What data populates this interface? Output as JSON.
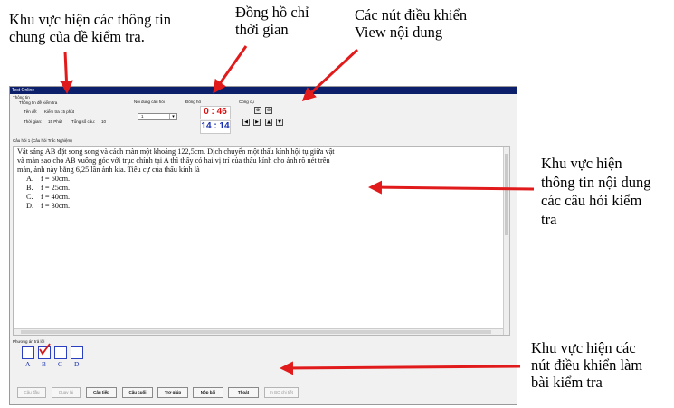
{
  "annotations": {
    "general_info": "Khu vực hiện các thông tin\nchung của đề kiểm tra.",
    "clock": "Đồng hồ chỉ\nthời gian",
    "view_controls": "Các nút điều khiển\nView nội dung",
    "question_area": "Khu vực hiện\nthông tin nội dung\ncác câu hỏi kiểm\ntra",
    "control_area": "Khu vực hiện các\nnút điều khiển làm\nbài kiểm tra"
  },
  "window": {
    "title": "Test Online",
    "info_group": "Thông tin",
    "exam_info_group": "Thông tin đề kiểm tra",
    "exam_name_label": "Tên đề:",
    "exam_name": "Kiểm tra 15 phút",
    "time_label": "Thời gian:",
    "time_value": "15 Phút",
    "count_label": "Tổng số câu:",
    "count_value": "10",
    "question_select_label": "Nội dung câu hỏi",
    "question_select_value": "1",
    "clock_label": "Đồng hồ",
    "clock_minutes": "0 : 46",
    "clock_seconds": "14 : 14",
    "tools_label": "Công cụ"
  },
  "question": {
    "header": "Câu hỏi 1 (Câu hỏi Trắc Nghiệm)",
    "line1": "Vật sáng AB đặt song song và cách màn một khoảng 122,5cm. Dịch chuyển một thấu kính hội tụ giữa vật",
    "line2": "và màn sao cho AB vuông góc với trục chính tại A thì thấy có hai vị trí của thấu kính cho ảnh rõ nét trên",
    "line3": "màn, ảnh này bằng 6,25 lần ảnh kia. Tiêu cự của thấu kính là",
    "options": [
      {
        "letter": "A.",
        "text": "f = 60cm."
      },
      {
        "letter": "B.",
        "text": "f = 25cm."
      },
      {
        "letter": "C.",
        "text": "f = 40cm."
      },
      {
        "letter": "D.",
        "text": "f = 30cm."
      }
    ]
  },
  "answer": {
    "label": "Phương án trả lời",
    "letters": [
      "A",
      "B",
      "C",
      "D"
    ],
    "selected": "B"
  },
  "buttons": {
    "first": "Câu đầu",
    "back": "Quay lại",
    "next": "Câu tiếp",
    "last": "Câu cuối",
    "help": "Trợ giúp",
    "submit": "Nộp bài",
    "exit": "Thoát",
    "print": "In BQ chi tiết"
  }
}
